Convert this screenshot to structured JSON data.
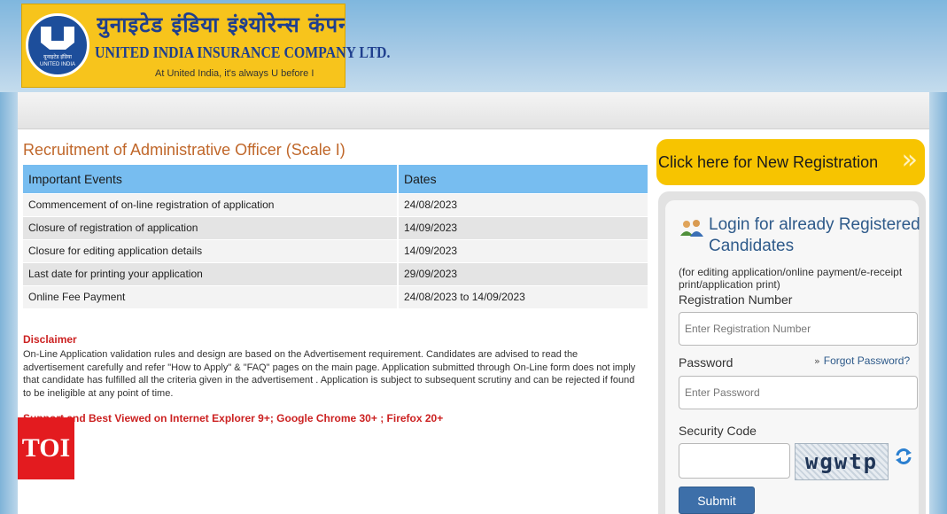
{
  "header": {
    "hindi_name": "युनाइटेड इंडिया इंश्योरेन्स कंपनी लिमिटेड",
    "english_name": "UNITED INDIA INSURANCE COMPANY LTD.",
    "tagline": "At United India, it's always U before I",
    "logo_seal_hindi": "यूनाइटेड इंडिया",
    "logo_seal_english": "UNITED INDIA"
  },
  "main": {
    "page_title": "Recruitment of Administrative Officer (Scale I)",
    "table": {
      "headers": [
        "Important Events",
        "Dates"
      ],
      "rows": [
        {
          "event": "Commencement of on-line registration of application",
          "date": "24/08/2023"
        },
        {
          "event": "Closure of registration of application",
          "date": "14/09/2023"
        },
        {
          "event": "Closure for editing application details",
          "date": "14/09/2023"
        },
        {
          "event": "Last date for printing your application",
          "date": "29/09/2023"
        },
        {
          "event": "Online Fee Payment",
          "date": "24/08/2023 to 14/09/2023"
        }
      ]
    },
    "disclaimer_title": "Disclaimer",
    "disclaimer_text": "On-Line Application validation rules and design are based on the Advertisement requirement. Candidates are advised to read the advertisement carefully and refer \"How to Apply\" & \"FAQ\" pages on the main page. Application submitted through On-Line form does not imply that candidate has fulfilled all the criteria given in the advertisement . Application is subject to subsequent scrutiny and can be rejected if found to be ineligible at any point of time.",
    "support_text": "Support and Best Viewed on Internet Explorer 9+; Google Chrome 30+ ; Firefox 20+"
  },
  "sidebar": {
    "new_registration": "Click here for New Registration",
    "login_title": "Login for already Registered Candidates",
    "login_note": "(for editing application/online payment/e-receipt print/application print)",
    "registration_label": "Registration Number",
    "registration_placeholder": "Enter Registration Number",
    "password_label": "Password",
    "password_placeholder": "Enter Password",
    "forgot_password": "Forgot Password?",
    "security_code_label": "Security Code",
    "captcha_text": "wgwtp",
    "submit_label": "Submit"
  },
  "watermark": {
    "label": "TOI"
  },
  "colors": {
    "banner": "#f7c41c",
    "brand_blue": "#1f3f8e",
    "table_header": "#77bdf0",
    "title_orange": "#c0672a",
    "disclaimer_red": "#cc2222",
    "submit_blue": "#3d6fa9",
    "toi_red": "#e31b1f"
  }
}
